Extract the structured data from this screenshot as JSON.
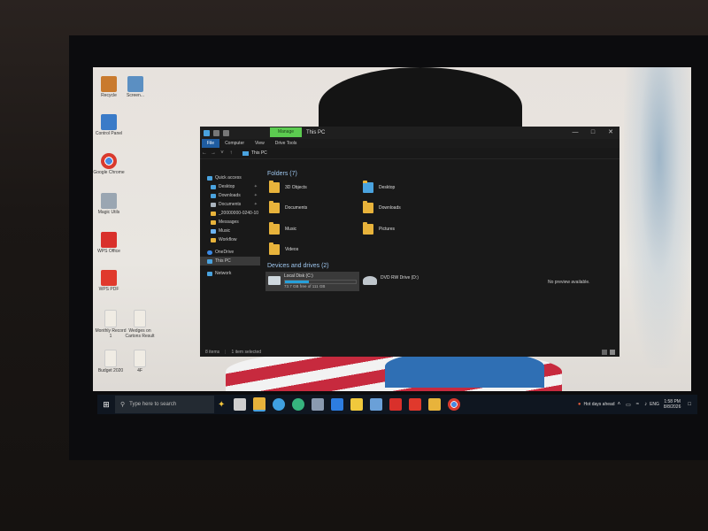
{
  "desktop_icons": [
    {
      "label": "Recycle",
      "icon": "recycle-bin-icon",
      "color": "#c97a2e"
    },
    {
      "label": "Screen...",
      "icon": "screen-icon",
      "color": "#5b8fc2"
    },
    {
      "label": "Control Panel",
      "icon": "control-panel-icon",
      "color": "#3a7bc8"
    },
    {
      "label": "Google Chrome",
      "icon": "chrome-icon",
      "color": "#d93a2e"
    },
    {
      "label": "Magic Utils",
      "icon": "utility-icon",
      "color": "#9aa6b2"
    },
    {
      "label": "WPS Office",
      "icon": "wps-office-icon",
      "color": "#d9302b"
    },
    {
      "label": "WPS PDF",
      "icon": "wps-pdf-icon",
      "color": "#e0392c"
    },
    {
      "label": "Monthly Record 1",
      "icon": "document-icon",
      "color": "#f0ece4"
    },
    {
      "label": "Wedges on Cartons Result",
      "icon": "document-icon",
      "color": "#f0ece4"
    },
    {
      "label": "Budget 2020",
      "icon": "document-icon",
      "color": "#f0ece4"
    },
    {
      "label": "4F",
      "icon": "document-icon",
      "color": "#f0ece4"
    }
  ],
  "explorer": {
    "manage_tab": "Manage",
    "title": "This PC",
    "ribbon_tabs": [
      "File",
      "Computer",
      "View",
      "Drive Tools"
    ],
    "address": "This PC",
    "nav_items": [
      {
        "label": "Quick access",
        "type": "header",
        "color": "#4aa3df"
      },
      {
        "label": "Desktop",
        "type": "sub",
        "pinned": true,
        "color": "#4aa3df"
      },
      {
        "label": "Downloads",
        "type": "sub",
        "pinned": true,
        "color": "#4aa3df"
      },
      {
        "label": "Documents",
        "type": "sub",
        "pinned": true,
        "color": "#aab4be"
      },
      {
        "label": "_20000000-0240-10",
        "type": "sub",
        "pinned": false,
        "color": "#e8b33b"
      },
      {
        "label": "Messages",
        "type": "sub",
        "pinned": false,
        "color": "#e8b33b"
      },
      {
        "label": "Music",
        "type": "sub",
        "pinned": false,
        "color": "#6db3f2"
      },
      {
        "label": "Workflow",
        "type": "sub",
        "pinned": false,
        "color": "#e8b33b"
      },
      {
        "label": "OneDrive",
        "type": "header",
        "color": "#3b8ae6"
      },
      {
        "label": "This PC",
        "type": "header",
        "selected": true,
        "color": "#4aa3df"
      },
      {
        "label": "Network",
        "type": "header",
        "color": "#4aa3df"
      }
    ],
    "folders_header": "Folders (7)",
    "folders": [
      "3D Objects",
      "Desktop",
      "Documents",
      "Downloads",
      "Music",
      "Pictures",
      "Videos"
    ],
    "devices_header": "Devices and drives (2)",
    "drives": [
      {
        "name": "Local Disk (C:)",
        "free": "73.7 GB free of 111 GB",
        "used_fraction": 0.34
      },
      {
        "name": "DVD RW Drive (D:)"
      }
    ],
    "preview_text": "No preview available.",
    "status": {
      "items": "8 items",
      "selected": "1 item selected"
    }
  },
  "taskbar": {
    "search_placeholder": "Type here to search",
    "apps": [
      {
        "icon": "task-view-icon",
        "color": "#cfcfcf"
      },
      {
        "icon": "file-explorer-icon",
        "color": "#e8b33b"
      },
      {
        "icon": "edge-icon",
        "color": "#3fa0e0"
      },
      {
        "icon": "edge-dev-icon",
        "color": "#36b37e"
      },
      {
        "icon": "mail-icon",
        "color": "#8a9ab0"
      },
      {
        "icon": "store-icon",
        "color": "#2d7de0"
      },
      {
        "icon": "sticky-notes-icon",
        "color": "#f0c93c"
      },
      {
        "icon": "photos-icon",
        "color": "#6aa0d8"
      },
      {
        "icon": "wps-icon",
        "color": "#d9302b"
      },
      {
        "icon": "pdf-icon",
        "color": "#e0392c"
      },
      {
        "icon": "folder-app-icon",
        "color": "#e8b33b"
      },
      {
        "icon": "chrome-icon",
        "color": "#d93a2e"
      }
    ],
    "weather": "Hot days ahead",
    "language": "ENG",
    "time": "1:58 PM",
    "date": "8/8/2026"
  }
}
